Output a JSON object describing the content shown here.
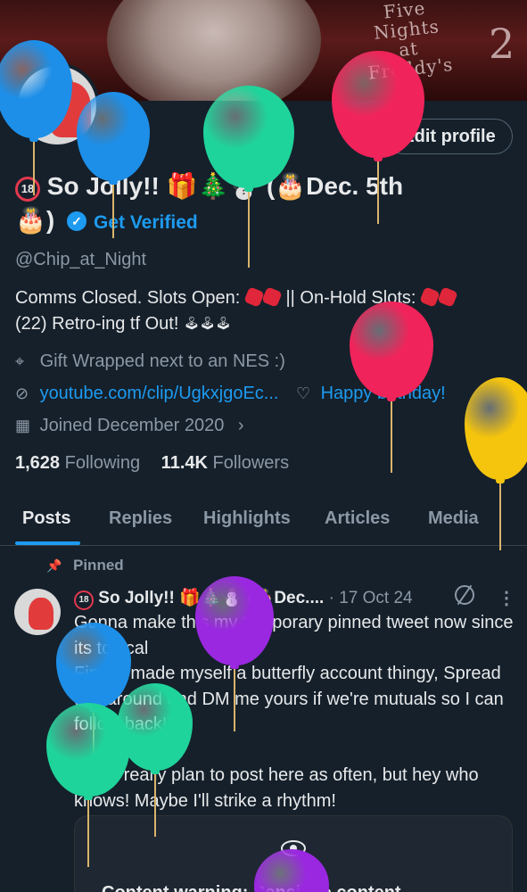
{
  "banner": {
    "title_lines": [
      "Five",
      "Nights",
      "at",
      "Freddy's"
    ],
    "number": "2"
  },
  "profile": {
    "edit_label": "Edit profile",
    "name_part1": "So Jolly!!",
    "name_part2": "Dec. 5th",
    "get_verified": "Get Verified",
    "handle": "@Chip_at_Night",
    "bio_part1": "Comms Closed. Slots Open:",
    "bio_part2": "|| On-Hold Slots:",
    "bio_part3": "(22)  Retro-ing tf Out!",
    "location": "Gift Wrapped next to an NES :)",
    "link": "youtube.com/clip/UgkxjgoEc...",
    "birthday": "Happy birthday!",
    "joined": "Joined December 2020",
    "following_count": "1,628",
    "following_label": "Following",
    "followers_count": "11.4K",
    "followers_label": "Followers"
  },
  "tabs": [
    "Posts",
    "Replies",
    "Highlights",
    "Articles",
    "Media"
  ],
  "post": {
    "pinned_label": "Pinned",
    "author": "So Jolly!!",
    "author_trunc": "Dec....",
    "date": "· 17 Oct 24",
    "body": "Gonna make this my temporary pinned tweet now since its topical\nFinally made myself a butterfly account thingy, Spread this around and DM me yours if we're mutuals so I can follow back!!\n\nI dont really plan to post here as often, but hey who knows! Maybe I'll strike a rhythm!",
    "card_text": "Content warning: Sensitive content"
  },
  "icons": {
    "location": "map-pin-icon",
    "link": "link-icon",
    "birthday": "balloon-icon",
    "joined": "calendar-icon",
    "pin": "pin-icon",
    "grok": "grok-icon",
    "more": "more-icon",
    "verified": "verified-badge-icon",
    "eye": "eye-icon"
  },
  "colors": {
    "background": "#15202b",
    "accent": "#1d9bf0",
    "text": "#e7e9ea",
    "muted": "#8b98a5",
    "balloon_blue": "#1d8fe8",
    "balloon_green": "#1fd49a",
    "balloon_red": "#f0245a",
    "balloon_yellow": "#f5c40d",
    "balloon_purple": "#9a28e0"
  }
}
